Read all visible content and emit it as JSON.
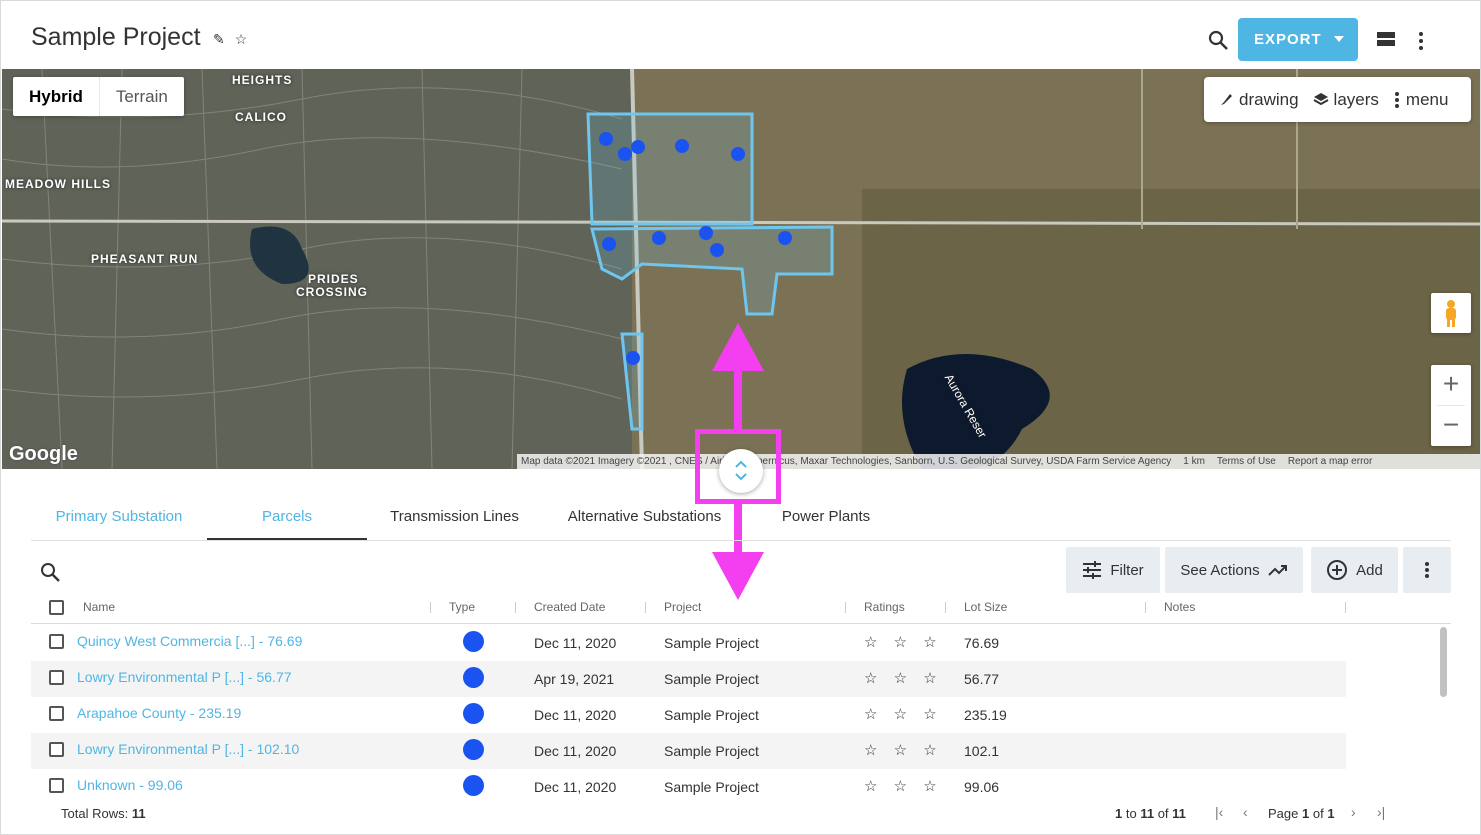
{
  "header": {
    "title": "Sample Project",
    "export_label": "EXPORT",
    "icons": [
      "pencil-icon",
      "star-outline-icon",
      "search-icon",
      "caret-down-icon",
      "view-toggle-icon",
      "more-vert-icon"
    ]
  },
  "map": {
    "type_options": [
      "Hybrid",
      "Terrain"
    ],
    "selected_type": "Hybrid",
    "tools": {
      "drawing": "drawing",
      "layers": "layers",
      "menu": "menu"
    },
    "zoom_in": "+",
    "zoom_out": "−",
    "logo": "Google",
    "attribution": "Map data ©2021 Imagery ©2021 , CNES / Airbus, Copernicus, Maxar Technologies, Sanborn, U.S. Geological Survey, USDA Farm Service Agency",
    "scale": "1 km",
    "terms": "Terms of Use",
    "report": "Report a map error",
    "labels": {
      "heights": "HEIGHTS",
      "calico": "CALICO",
      "meadow_hills": "MEADOW HILLS",
      "pheasant_run": "PHEASANT RUN",
      "prides": "PRIDES",
      "crossing": "CROSSING",
      "aurora": "Aurora Reser"
    }
  },
  "tabs": [
    {
      "label": "Primary Substation",
      "state": "blue"
    },
    {
      "label": "Parcels",
      "state": "active"
    },
    {
      "label": "Transmission Lines",
      "state": "normal"
    },
    {
      "label": "Alternative Substations",
      "state": "normal"
    },
    {
      "label": "Power Plants",
      "state": "normal"
    }
  ],
  "toolbar": {
    "filter_label": "Filter",
    "actions_label": "See Actions",
    "add_label": "Add"
  },
  "table": {
    "columns": [
      "Name",
      "Type",
      "Created Date",
      "Project",
      "Ratings",
      "Lot Size",
      "Notes"
    ],
    "rows": [
      {
        "name": "Quincy West Commercia [...] - 76.69",
        "created": "Dec 11, 2020",
        "project": "Sample Project",
        "ratings": "☆ ☆ ☆",
        "lot_size": "76.69"
      },
      {
        "name": "Lowry Environmental P [...] - 56.77",
        "created": "Apr 19, 2021",
        "project": "Sample Project",
        "ratings": "☆ ☆ ☆",
        "lot_size": "56.77"
      },
      {
        "name": "Arapahoe County - 235.19",
        "created": "Dec 11, 2020",
        "project": "Sample Project",
        "ratings": "☆ ☆ ☆",
        "lot_size": "235.19"
      },
      {
        "name": "Lowry Environmental P [...] - 102.10",
        "created": "Dec 11, 2020",
        "project": "Sample Project",
        "ratings": "☆ ☆ ☆",
        "lot_size": "102.1"
      },
      {
        "name": "Unknown - 99.06",
        "created": "Dec 11, 2020",
        "project": "Sample Project",
        "ratings": "☆ ☆ ☆",
        "lot_size": "99.06"
      }
    ],
    "type_color": "#1a53f0"
  },
  "footer": {
    "total_label": "Total Rows:",
    "total_value": "11",
    "range_start": "1",
    "range_to": "to",
    "range_end": "11",
    "range_of": "of",
    "range_total": "11",
    "page_label": "Page",
    "page_current": "1",
    "page_of": "of",
    "page_total": "1"
  },
  "colors": {
    "accent": "#4fb6e3",
    "annotation": "#f43ff0",
    "parcel_outline": "#6ec6ee"
  }
}
